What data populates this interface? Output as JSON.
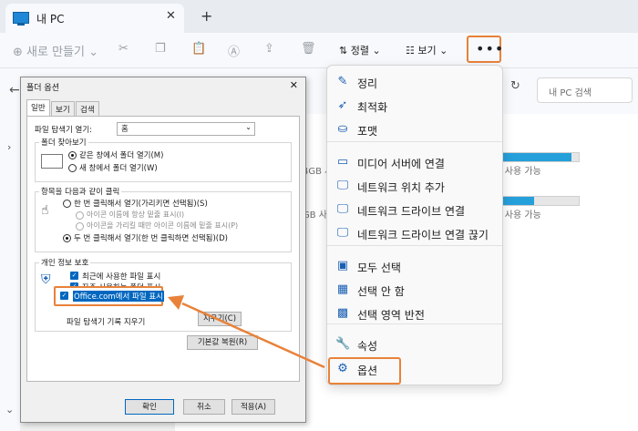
{
  "tab": {
    "title": "내 PC"
  },
  "toolbar": {
    "new_label": "새로 만들기",
    "sort_label": "정렬",
    "view_label": "보기",
    "more_label": "•••"
  },
  "search": {
    "placeholder": "내 PC 검색"
  },
  "drives": [
    {
      "text": "4GB 사용 가능",
      "usage": 0.08
    },
    {
      "text": "GB 사용 가능",
      "usage": 0.92
    },
    {
      "text": "GB 사용 가능",
      "usage": 0.5
    }
  ],
  "drive_left_texts": [
    "4GB 사",
    "GB 사"
  ],
  "dialog": {
    "title": "폴더 옵션",
    "tabs": [
      "일반",
      "보기",
      "검색"
    ],
    "open_label": "파일 탐색기 열기:",
    "open_value": "홈",
    "browse_group": "폴더 찾아보기",
    "browse_same": "같은 창에서 폴더 열기(M)",
    "browse_new": "새 창에서 폴더 열기(W)",
    "click_group": "항목을 다음과 같이 클릭",
    "click_single": "한 번 클릭해서 열기(가리키면 선택됨)(S)",
    "click_underline_title": "아이콘 이름에 항상 밑줄 표시(I)",
    "click_underline_hover": "아이콘을 가리킬 때만 아이콘 이름에 밑줄 표시(P)",
    "click_double": "두 번 클릭해서 열기(한 번 클릭하면 선택됨)(D)",
    "privacy_group": "개인 정보 보호",
    "privacy_recent": "최근에 사용한 파일 표시",
    "privacy_frequent": "자주 사용하는 폴더 표시",
    "privacy_office": "Office.com에서 파일 표시",
    "clear_history_label": "파일 탐색기 기록 지우기",
    "clear_button": "지우기(C)",
    "restore_button": "기본값 복원(R)",
    "ok": "확인",
    "cancel": "취소",
    "apply": "적용(A)"
  },
  "menu": {
    "items": [
      {
        "icon": "broom-icon",
        "glyph": "✎",
        "label": "정리"
      },
      {
        "icon": "rocket-icon",
        "glyph": "➶",
        "label": "최적화"
      },
      {
        "icon": "disk-icon",
        "glyph": "⛀",
        "label": "포맷"
      },
      {
        "icon": "media-server-icon",
        "glyph": "▭",
        "label": "미디어 서버에 연결"
      },
      {
        "icon": "network-location-icon",
        "glyph": "🖵",
        "label": "네트워크 위치 추가"
      },
      {
        "icon": "network-drive-icon",
        "glyph": "🖵",
        "label": "네트워크 드라이브 연결"
      },
      {
        "icon": "network-drive-disconnect-icon",
        "glyph": "🖵",
        "label": "네트워크 드라이브 연결 끊기"
      },
      {
        "icon": "select-all-icon",
        "glyph": "▣",
        "label": "모두 선택"
      },
      {
        "icon": "select-none-icon",
        "glyph": "▦",
        "label": "선택 안 함"
      },
      {
        "icon": "invert-selection-icon",
        "glyph": "▩",
        "label": "선택 영역 반전"
      },
      {
        "icon": "wrench-icon",
        "glyph": "🔧",
        "label": "속성"
      },
      {
        "icon": "gear-icon",
        "glyph": "⚙",
        "label": "옵션"
      }
    ]
  },
  "colors": {
    "highlight": "#e8823a",
    "accent": "#0067c0",
    "drive_bar": "#26a0da"
  }
}
